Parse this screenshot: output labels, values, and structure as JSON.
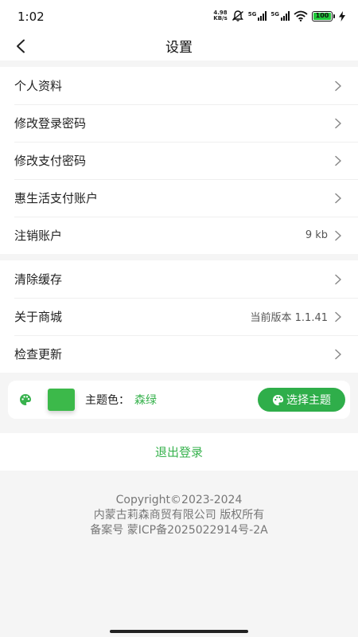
{
  "status_bar": {
    "time": "1:02",
    "net_speed_value": "4.98",
    "net_speed_unit": "KB/s",
    "signal1": "5G",
    "signal2": "5G",
    "battery": "100"
  },
  "header": {
    "title": "设置"
  },
  "group1": [
    {
      "label": "个人资料",
      "value": ""
    },
    {
      "label": "修改登录密码",
      "value": ""
    },
    {
      "label": "修改支付密码",
      "value": ""
    },
    {
      "label": "惠生活支付账户",
      "value": ""
    },
    {
      "label": "注销账户",
      "value": "9 kb"
    }
  ],
  "group2": [
    {
      "label": "清除缓存",
      "value": ""
    },
    {
      "label": "关于商城",
      "value": "当前版本 1.1.41"
    },
    {
      "label": "检查更新",
      "value": ""
    }
  ],
  "theme": {
    "label": "主题色：",
    "value": "森绿",
    "button_label": "选择主题",
    "swatch_color": "#3cb94a",
    "accent_color": "#37b24d",
    "button_color": "#2fae4a"
  },
  "logout": {
    "label": "退出登录"
  },
  "footer": {
    "line1": "Copyright©2023-2024",
    "line2": "内蒙古莉森商贸有限公司 版权所有",
    "line3": "备案号 蒙ICP备2025022914号-2A"
  },
  "icons": {
    "back": "back-arrow-icon",
    "chevron": "chevron-right-icon",
    "palette": "palette-icon",
    "mute": "muted-bell-icon",
    "wifi": "wifi-icon",
    "battery": "battery-icon",
    "charging": "charging-bolt-icon"
  }
}
